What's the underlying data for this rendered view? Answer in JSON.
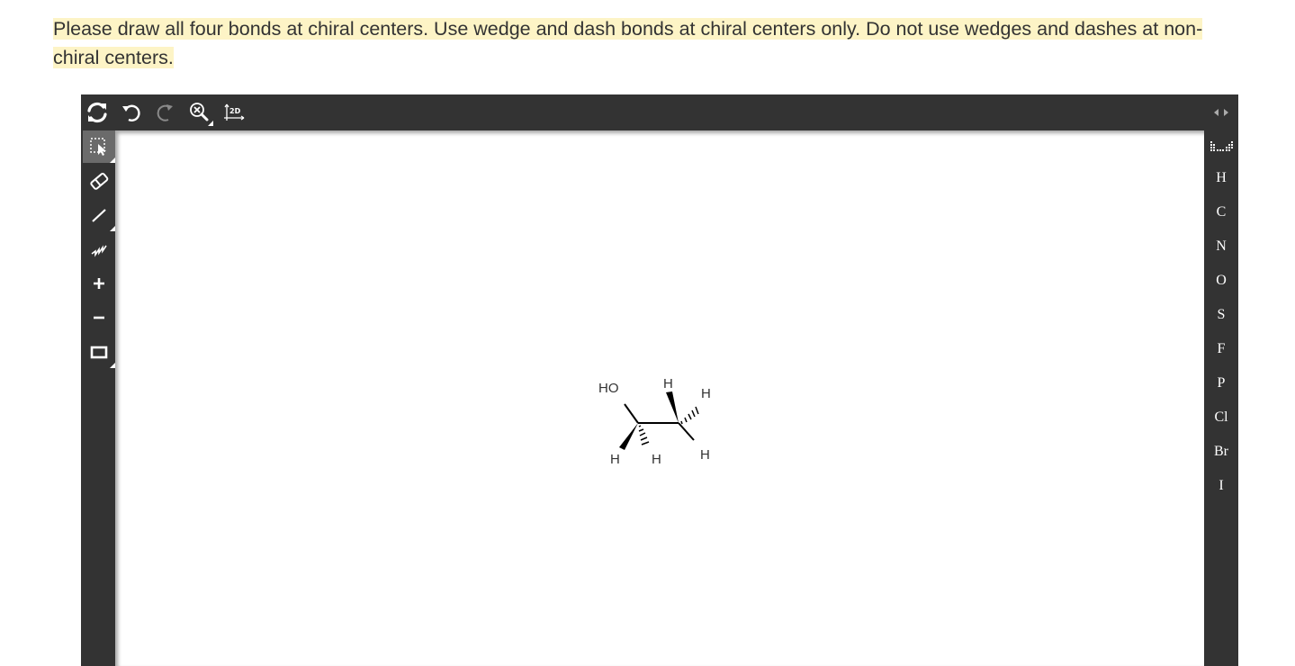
{
  "instructions": {
    "text": "Please draw all four bonds at chiral centers. Use wedge and dash bonds at chiral centers only. Do not use wedges and dashes at non-chiral centers."
  },
  "editor": {
    "background": "#333333",
    "canvas_background": "#ffffff",
    "top_toolbar": {
      "clean_icon": "clean-icon",
      "undo_icon": "undo-icon",
      "redo_icon": "redo-icon",
      "zoom_icon": "zoom-icon",
      "layout_label": "2D"
    },
    "left_toolbar": [
      {
        "name": "select-tool",
        "icon": "select-icon",
        "active": true
      },
      {
        "name": "erase-tool",
        "icon": "eraser-icon"
      },
      {
        "name": "single-bond-tool",
        "icon": "bond-icon"
      },
      {
        "name": "chain-tool",
        "icon": "chain-icon"
      },
      {
        "name": "charge-plus-tool",
        "icon": "plus-icon"
      },
      {
        "name": "charge-minus-tool",
        "icon": "minus-icon"
      },
      {
        "name": "shape-tool",
        "icon": "rectangle-icon"
      }
    ],
    "elements": [
      "H",
      "C",
      "N",
      "O",
      "S",
      "F",
      "P",
      "Cl",
      "Br",
      "I"
    ],
    "molecule": {
      "labels": {
        "ho": "HO",
        "h_top": "H",
        "h_top_right": "H",
        "h_bottom_left": "H",
        "h_bottom_mid": "H",
        "h_bottom_right": "H"
      }
    }
  }
}
